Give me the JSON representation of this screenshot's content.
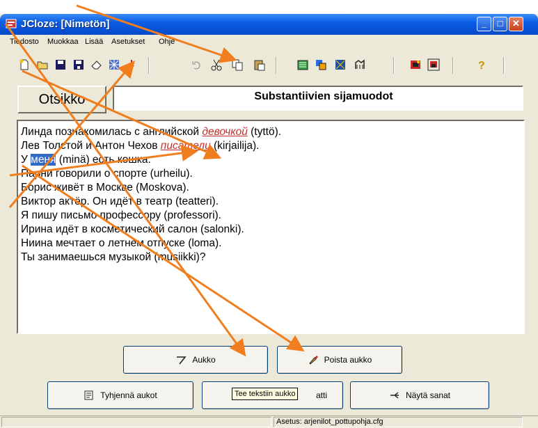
{
  "window": {
    "title": "JCloze: [Nimetön]",
    "controls": {
      "minimize": "_",
      "maximize": "□",
      "close": "✕"
    }
  },
  "menu": [
    "Tiedosto",
    "Muokkaa",
    "Lisää",
    "Asetukset",
    "Ohje"
  ],
  "toolbar": {
    "buttons": [
      "new-icon",
      "open-icon",
      "save-icon",
      "save-as-icon",
      "eraser-icon",
      "web-export-icon",
      "arrow-down-icon",
      "undo-icon",
      "cut-icon",
      "copy-icon",
      "paste-icon",
      "add-gap-icon",
      "export-icon",
      "export-frames-icon",
      "export-drag-icon",
      "reader-icon",
      "config-icon",
      "help-icon"
    ]
  },
  "header": {
    "otsikko_label": "Otsikko",
    "title_value": "Substantiivien sijamuodot"
  },
  "text": {
    "lines": [
      {
        "parts": [
          {
            "t": "Линда познакомилась с английской ",
            "s": "plain"
          },
          {
            "t": "девочкой",
            "s": "gap"
          },
          {
            "t": " (tyttö).",
            "s": "plain"
          }
        ]
      },
      {
        "parts": [
          {
            "t": "Лев Толстой и Антон Чехов ",
            "s": "plain"
          },
          {
            "t": "писатели",
            "s": "gap"
          },
          {
            "t": " (kirjailija).",
            "s": "plain"
          }
        ]
      },
      {
        "parts": [
          {
            "t": "У ",
            "s": "plain"
          },
          {
            "t": "меня",
            "s": "sel"
          },
          {
            "t": " (minä) есть кошка.",
            "s": "plain"
          }
        ]
      },
      {
        "parts": [
          {
            "t": "Парни говорили о спорте (urheilu).",
            "s": "plain"
          }
        ]
      },
      {
        "parts": [
          {
            "t": "Борис живёт в Москве (Moskova).",
            "s": "plain"
          }
        ]
      },
      {
        "parts": [
          {
            "t": "Виктор актёр. Он идёт в театр (teatteri).",
            "s": "plain"
          }
        ]
      },
      {
        "parts": [
          {
            "t": "Я пишу письмо профессору (professori).",
            "s": "plain"
          }
        ]
      },
      {
        "parts": [
          {
            "t": "Ирина идёт в косметический салон (salonki).",
            "s": "plain"
          }
        ]
      },
      {
        "parts": [
          {
            "t": "Ниина мечтает о летнем отпуске (loma).",
            "s": "plain"
          }
        ]
      },
      {
        "parts": [
          {
            "t": "Ты занимаешься музыкой (musiikki)?",
            "s": "plain"
          }
        ]
      }
    ]
  },
  "buttons": {
    "aukko": "Aukko",
    "poista_aukko": "Poista aukko",
    "tyhjenna": "Tyhjennä aukot",
    "middle_tail": "atti",
    "nayta": "Näytä sanat"
  },
  "tooltip": "Tee tekstiin aukko",
  "status": {
    "config": "Asetus: arjenilot_pottupohja.cfg"
  },
  "colors": {
    "arrow": "#f07d1e",
    "gap": "#c0302c",
    "selection": "#316ac5"
  }
}
